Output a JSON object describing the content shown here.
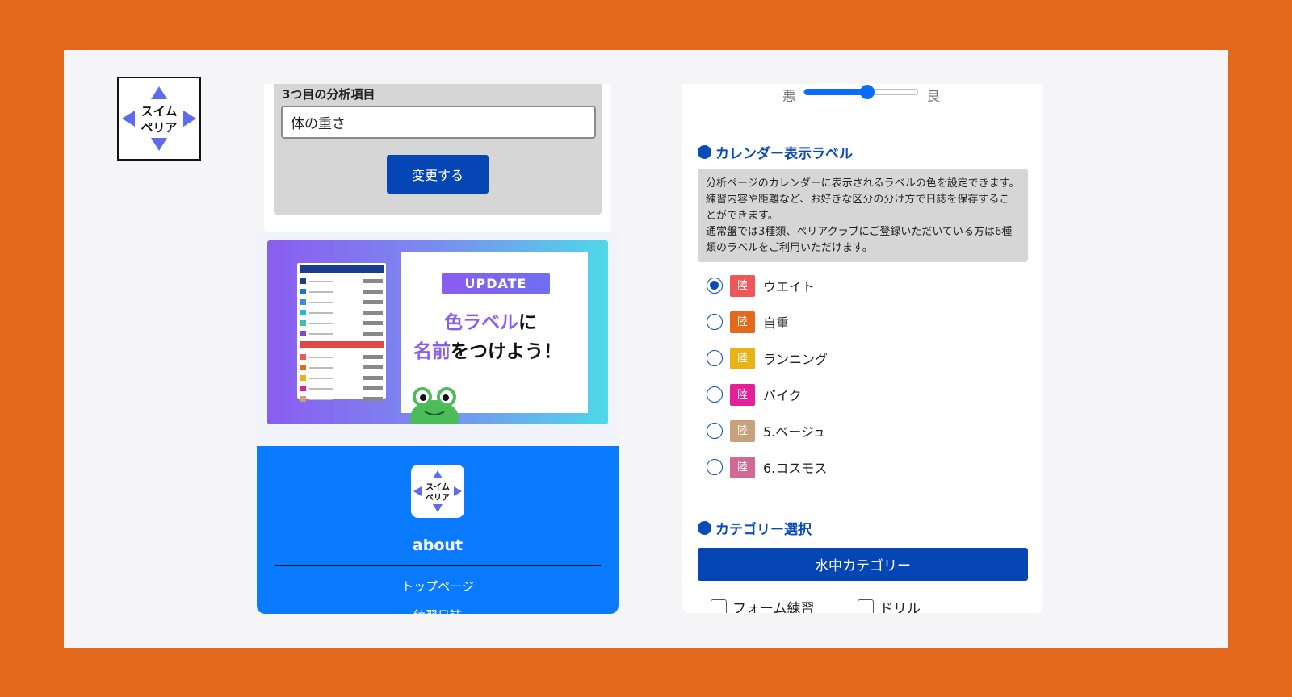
{
  "logo": {
    "line1": "スイム",
    "line2": "ペリア"
  },
  "analysis_setting": {
    "label": "3つ目の分析項目",
    "input_value": "体の重さ",
    "button": "変更する"
  },
  "banner": {
    "badge": "UPDATE",
    "line1_highlight": "色ラベル",
    "line1_rest": "に",
    "line2_highlight": "名前",
    "line2_rest": "をつけよう！"
  },
  "footer": {
    "title": "about",
    "links": [
      "トップページ",
      "練習日誌"
    ]
  },
  "slider": {
    "bad": "悪",
    "good": "良",
    "level_fraction": 0.55
  },
  "calendar_section": {
    "heading": "カレンダー表示ラベル",
    "description": "分析ページのカレンダーに表示されるラベルの色を設定できます。練習内容や距離など、お好きな区分の分け方で日誌を保存することができます。\n通常盤では3種類、ペリアクラブにご登録いただいている方は6種類のラベルをご利用いただけます。",
    "labels": [
      {
        "chip": "陸",
        "name": "ウエイト",
        "color": "#f0555a",
        "selected": true
      },
      {
        "chip": "陸",
        "name": "自重",
        "color": "#e5691d",
        "selected": false
      },
      {
        "chip": "陸",
        "name": "ランニング",
        "color": "#e8b218",
        "selected": false
      },
      {
        "chip": "陸",
        "name": "バイク",
        "color": "#e51e9a",
        "selected": false
      },
      {
        "chip": "陸",
        "name": "5.ベージュ",
        "color": "#c8a07c",
        "selected": false
      },
      {
        "chip": "陸",
        "name": "6.コスモス",
        "color": "#d06a92",
        "selected": false
      }
    ]
  },
  "category_section": {
    "heading": "カテゴリー選択",
    "button": "水中カテゴリー",
    "checkboxes": [
      "フォーム練習",
      "ドリル"
    ]
  },
  "colors": {
    "background": "#e5691d",
    "primary": "#0646b4",
    "footer": "#0a7bff"
  }
}
